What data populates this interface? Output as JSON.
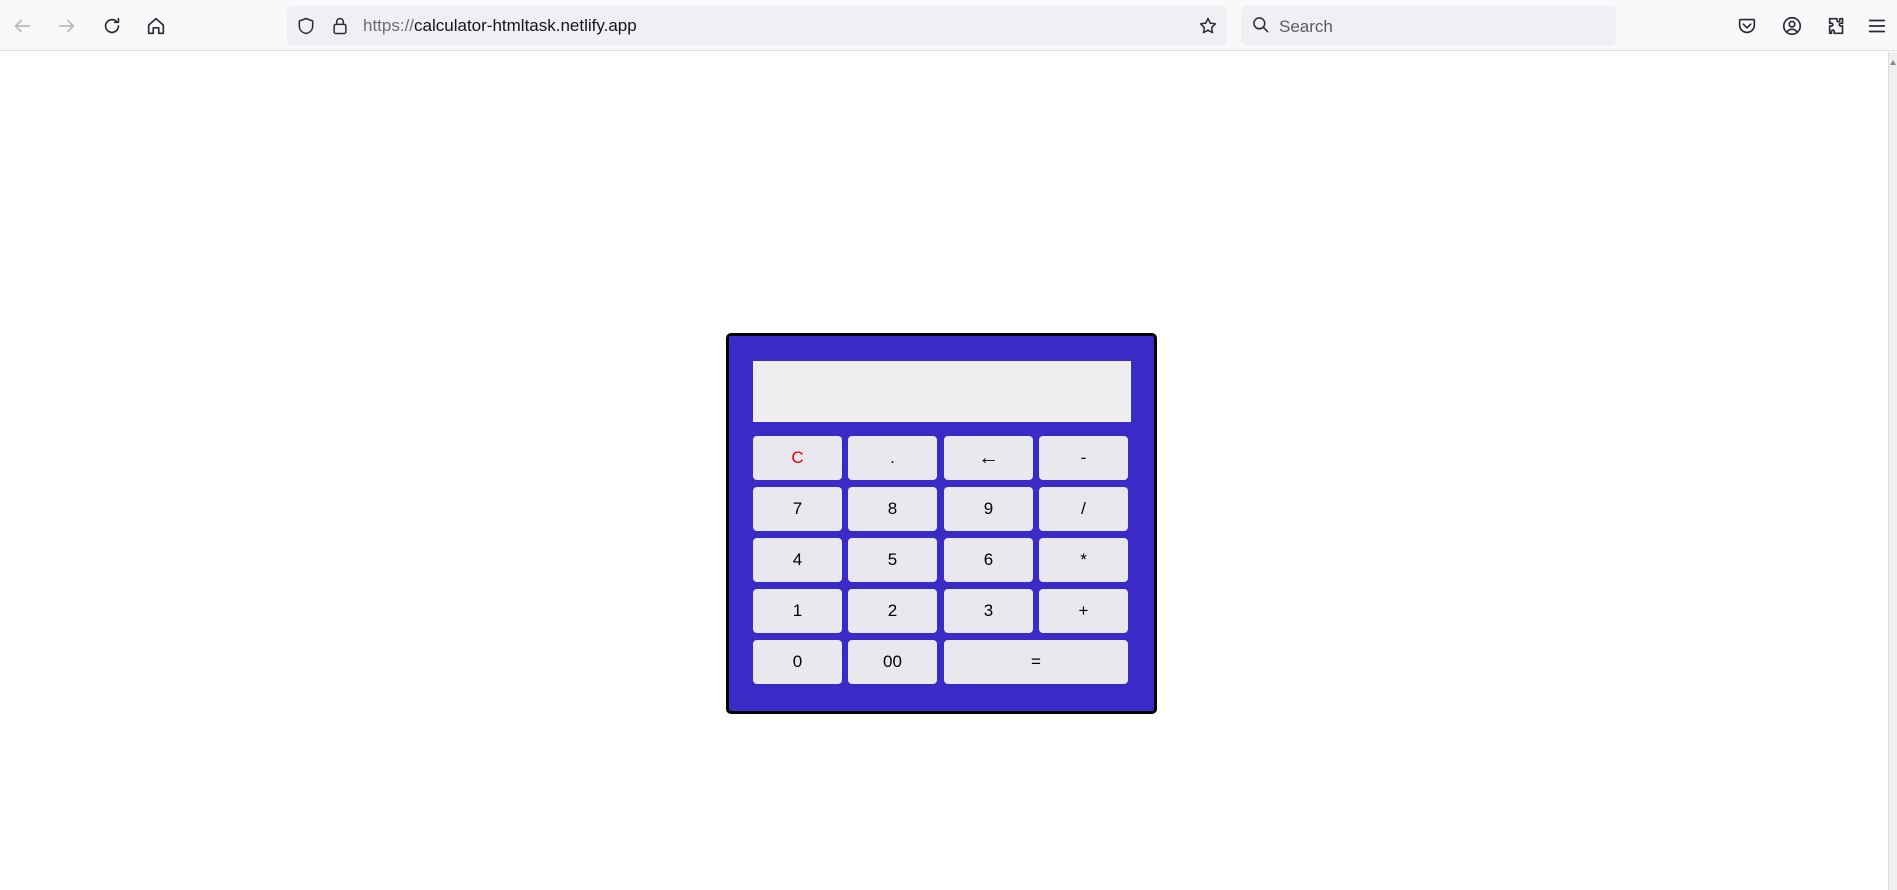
{
  "browser": {
    "url_scheme": "https://",
    "url_host": "calculator-htmltask.netlify.app",
    "search_placeholder": "Search"
  },
  "calculator": {
    "display_value": "",
    "rows": [
      [
        "C",
        ".",
        "←",
        "-"
      ],
      [
        "7",
        "8",
        "9",
        "/"
      ],
      [
        "4",
        "5",
        "6",
        "*"
      ],
      [
        "1",
        "2",
        "3",
        "+"
      ],
      [
        "0",
        "00",
        "="
      ]
    ],
    "colors": {
      "body": "#3a2bc7",
      "key": "#e9e8ee",
      "display": "#eeeeee",
      "clear_text": "#e00000"
    }
  }
}
